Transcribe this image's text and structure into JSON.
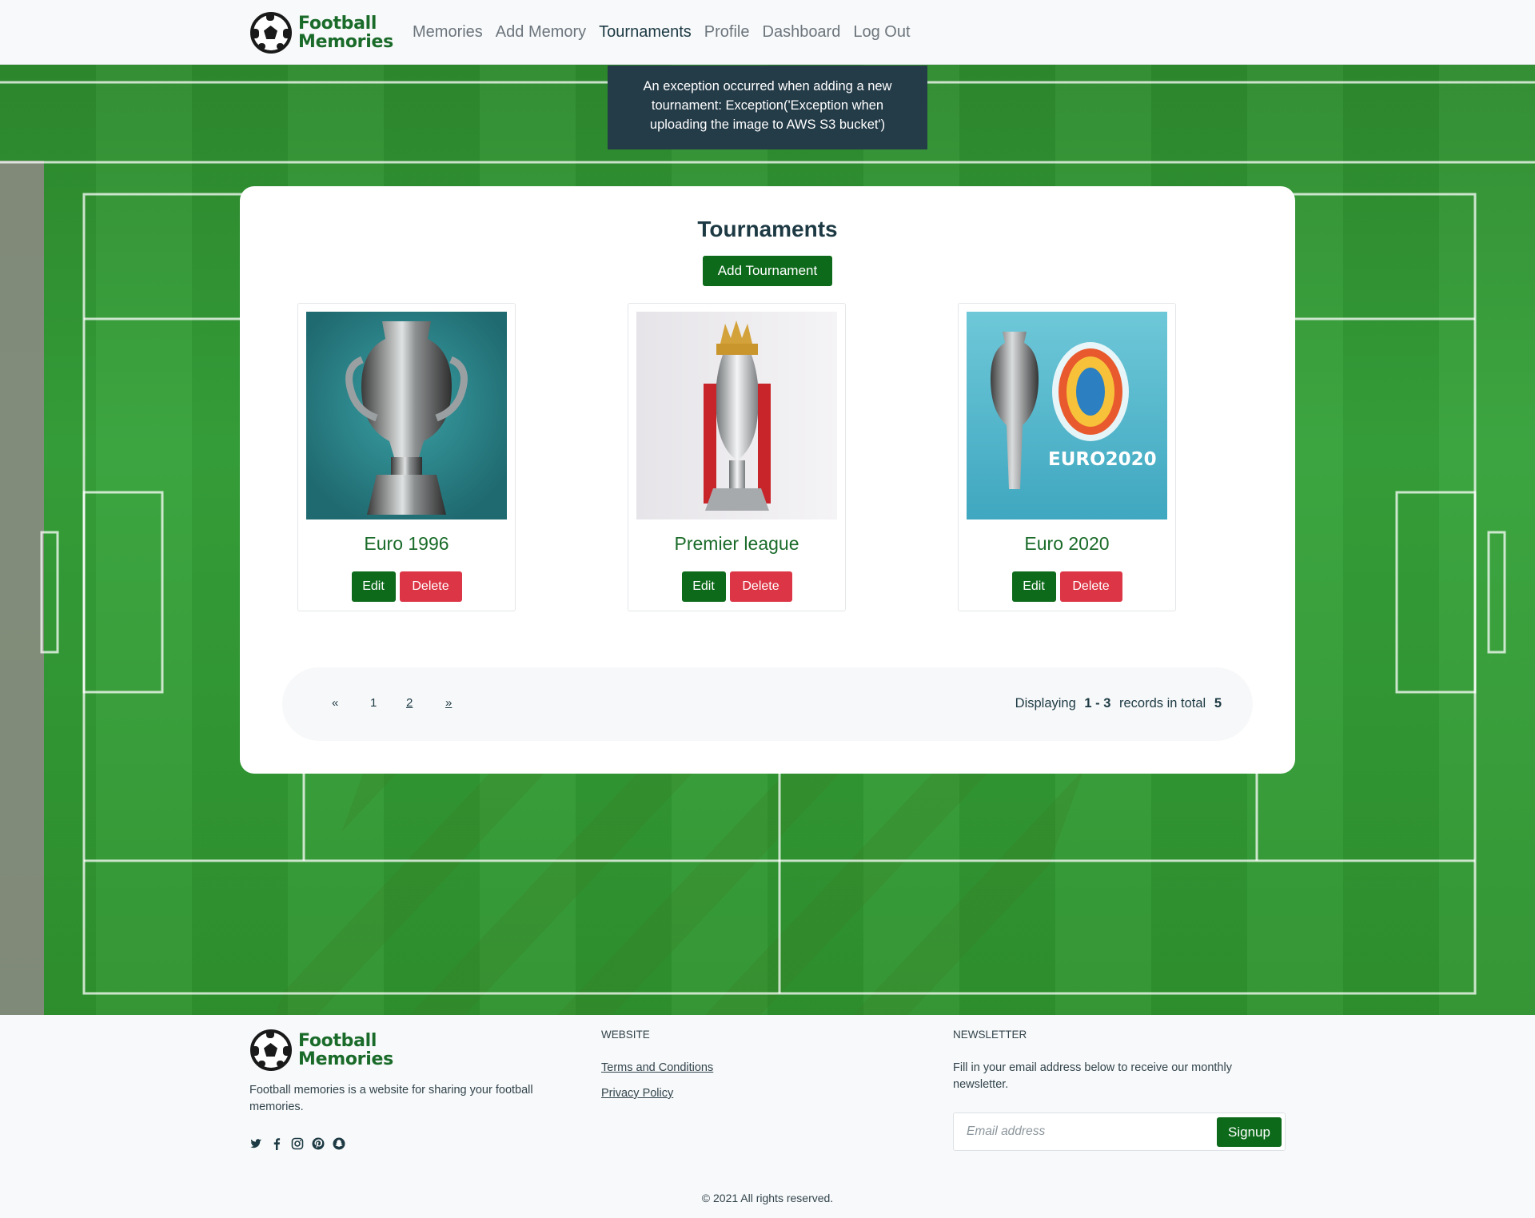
{
  "navbar": {
    "brand_line1": "Football",
    "brand_line2": "Memories",
    "links": [
      "Memories",
      "Add Memory",
      "Tournaments",
      "Profile",
      "Dashboard",
      "Log Out"
    ],
    "active": "Tournaments"
  },
  "alert": {
    "message": "An exception occurred when adding a new tournament: Exception('Exception when uploading the image to AWS S3 bucket')"
  },
  "main": {
    "title": "Tournaments",
    "add_button": "Add Tournament",
    "tournaments": [
      {
        "name": "Euro 1996",
        "edit_label": "Edit",
        "delete_label": "Delete",
        "image": "trophy-icon"
      },
      {
        "name": "Premier league",
        "edit_label": "Edit",
        "delete_label": "Delete",
        "image": "trophy-icon"
      },
      {
        "name": "Euro 2020",
        "edit_label": "Edit",
        "delete_label": "Delete",
        "image": "trophy-icon",
        "image_text": "EURO2020"
      }
    ],
    "pagination": {
      "prev": "«",
      "pages": [
        "1",
        "2"
      ],
      "next": "»",
      "info_prefix": "Displaying",
      "range": "1 - 3",
      "info_middle": "records in total",
      "total": "5"
    }
  },
  "footer": {
    "brand_line1": "Football",
    "brand_line2": "Memories",
    "about": "Football memories is a website for sharing your football memories.",
    "socials": [
      "twitter-icon",
      "facebook-icon",
      "instagram-icon",
      "pinterest-icon",
      "snapchat-icon"
    ],
    "website_heading": "WEBSITE",
    "website_links": [
      "Terms and Conditions",
      "Privacy Policy"
    ],
    "newsletter_heading": "NEWSLETTER",
    "newsletter_text": "Fill in your email address below to receive our monthly newsletter.",
    "email_placeholder": "Email address",
    "signup_label": "Signup",
    "copyright": "© 2021 All rights reserved."
  },
  "colors": {
    "brand_green": "#0d6a1a",
    "danger_red": "#dc3545",
    "alert_bg": "#243b48",
    "field_green": "#36a23a"
  }
}
